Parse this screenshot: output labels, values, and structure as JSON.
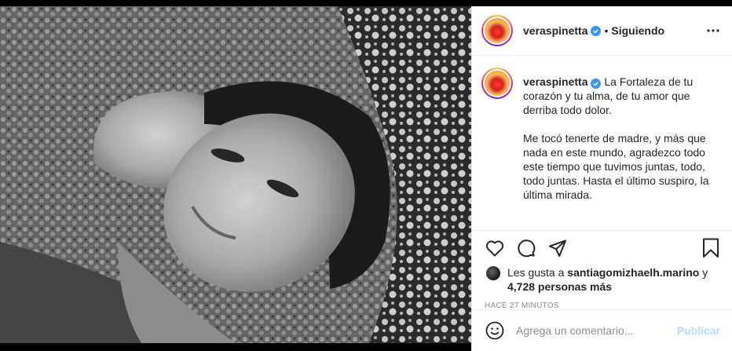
{
  "post": {
    "username": "veraspinetta",
    "follow_status": "Siguiendo",
    "separator": "•",
    "caption_paragraphs": [
      "La Fortaleza de tu corazón y tu alma, de tu amor que derriba todo dolor.",
      "Me tocó tenerte de madre, y más que nada en este mundo, agradezco todo este tiempo que tuvimos juntas, todo, todo juntas. Hasta el último suspiro, la última mirada."
    ],
    "likes_prefix": "Les gusta a",
    "likes_user": "santiagomizhaelh.marino",
    "likes_conj": "y",
    "likes_count": "4,728 personas más",
    "timestamp": "Hace 27 minutos",
    "comment_placeholder": "Agrega un comentario...",
    "publish_label": "Publicar"
  },
  "icons": {
    "verified": "verified-badge-icon",
    "more": "more-options-icon",
    "like": "heart-icon",
    "comment": "comment-bubble-icon",
    "share": "paper-plane-icon",
    "save": "bookmark-icon",
    "emoji": "emoji-smiley-icon"
  },
  "colors": {
    "verified_blue": "#3897f0",
    "publish_disabled": "#b3dbff",
    "muted_text": "#8e8e8e"
  }
}
